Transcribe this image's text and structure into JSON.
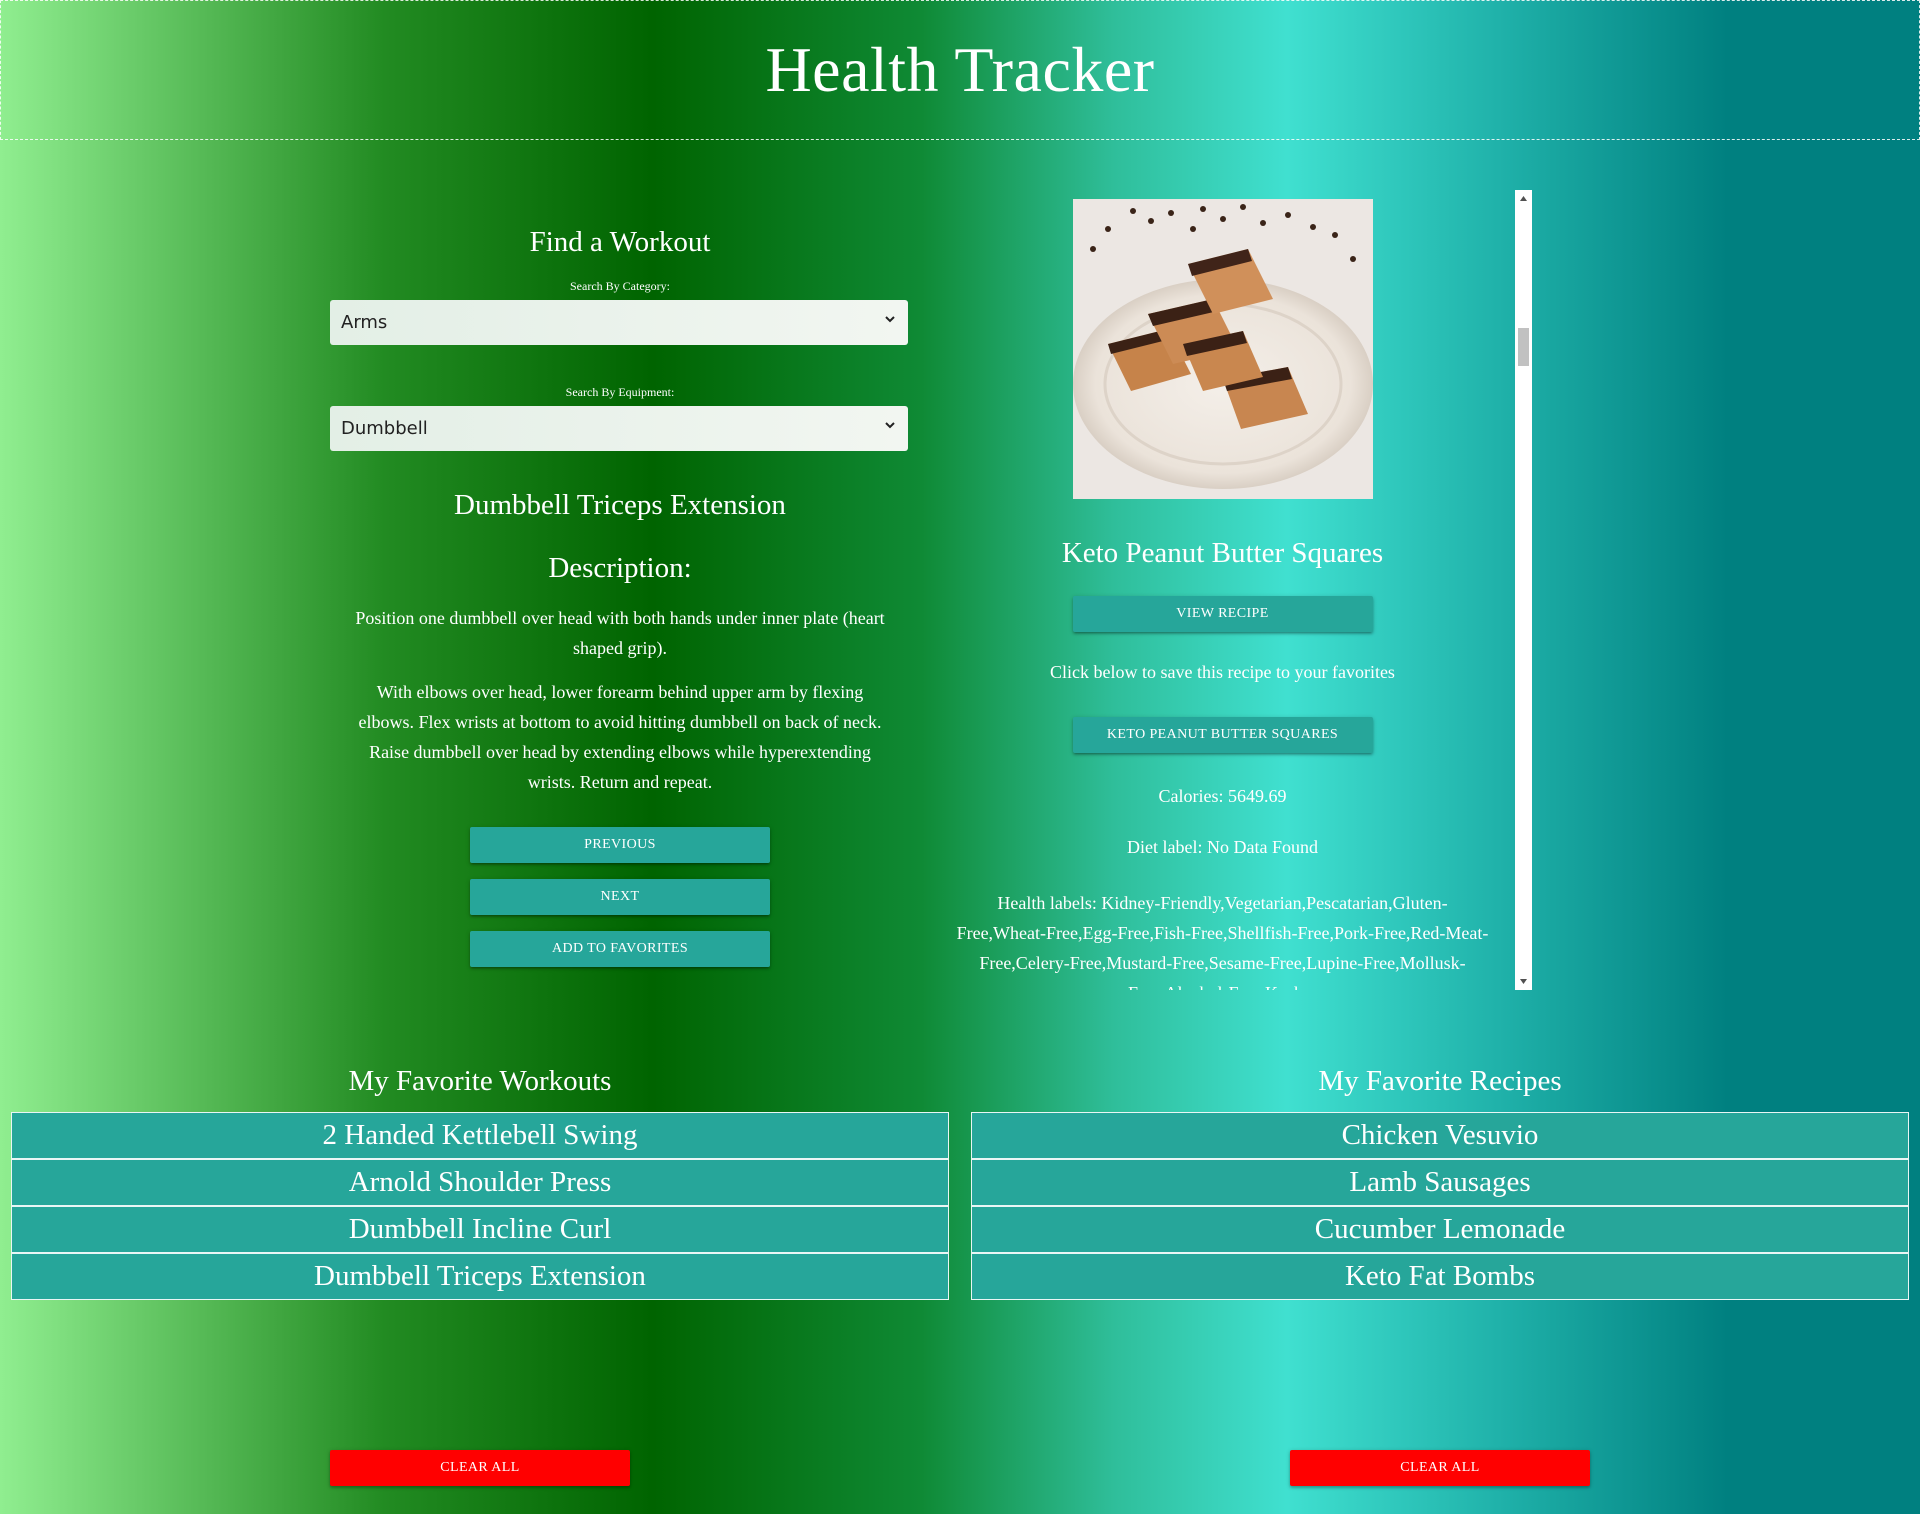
{
  "header": {
    "title": "Health Tracker"
  },
  "workout_finder": {
    "title": "Find a Workout",
    "category_label": "Search By Category:",
    "category_value": "Arms",
    "equipment_label": "Search By Equipment:",
    "equipment_value": "Dumbbell",
    "workout_name": "Dumbbell Triceps Extension",
    "description_title": "Description:",
    "description": [
      "Position one dumbbell over head with both hands under inner plate (heart shaped grip).",
      "With elbows over head, lower forearm behind upper arm by flexing elbows. Flex wrists at bottom to avoid hitting dumbbell on back of neck. Raise dumbbell over head by extending elbows while hyperextending wrists. Return and repeat."
    ],
    "buttons": {
      "previous": "PREVIOUS",
      "next": "NEXT",
      "add_favorites": "ADD TO FAVORITES"
    }
  },
  "recipe": {
    "title": "Keto Peanut Butter Squares",
    "view_button": "VIEW RECIPE",
    "save_text": "Click below to save this recipe to your favorites",
    "save_button": "KETO PEANUT BUTTER SQUARES",
    "calories": "Calories: 5649.69",
    "diet_label": "Diet label: No Data Found",
    "health_labels": "Health labels: Kidney-Friendly,Vegetarian,Pescatarian,Gluten-Free,Wheat-Free,Egg-Free,Fish-Free,Shellfish-Free,Pork-Free,Red-Meat-Free,Celery-Free,Mustard-Free,Sesame-Free,Lupine-Free,Mollusk-Free,Alcohol-Free,Kosher"
  },
  "favorite_workouts": {
    "title": "My Favorite Workouts",
    "items": [
      "2 Handed Kettlebell Swing",
      "Arnold Shoulder Press",
      "Dumbbell Incline Curl",
      "Dumbbell Triceps Extension"
    ],
    "clear_button": "CLEAR ALL"
  },
  "favorite_recipes": {
    "title": "My Favorite Recipes",
    "items": [
      "Chicken Vesuvio",
      "Lamb Sausages",
      "Cucumber Lemonade",
      "Keto Fat Bombs"
    ],
    "clear_button": "CLEAR ALL"
  },
  "colors": {
    "accent_button": "#26a69a",
    "clear_button": "#ff0000",
    "gradient": [
      "#90ee90",
      "#228b22",
      "#006400",
      "#40e0d0",
      "#20b2aa",
      "#008080"
    ]
  },
  "icons": {
    "select_arrow": "chevron-down-icon",
    "scroll_up": "arrow-up-icon",
    "scroll_down": "arrow-down-icon"
  }
}
